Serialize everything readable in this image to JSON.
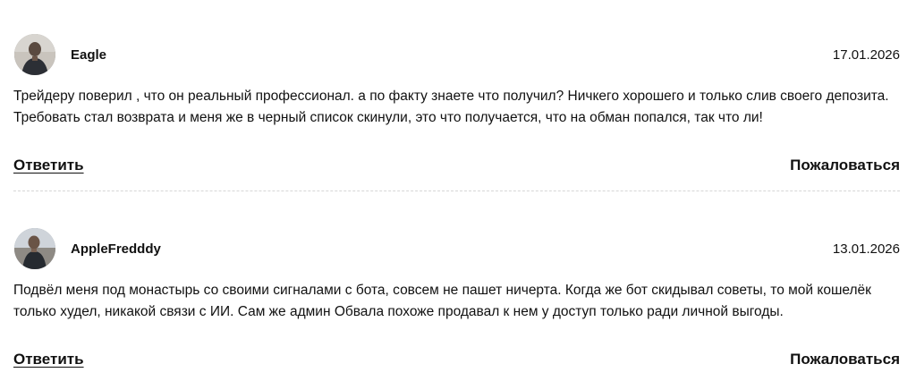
{
  "comments": [
    {
      "author": "Eagle",
      "date": "17.01.2026",
      "text": "Трейдеру поверил , что он реальный профессионал. а по факту знаете что получил? Ничкего хорошего и только слив своего депозита. Требовать стал возврата и меня же в черный список скинули, это что получается, что на обман попался, так что ли!",
      "reply_label": "Ответить",
      "report_label": "Пожаловаться"
    },
    {
      "author": "AppleFredddy",
      "date": "13.01.2026",
      "text": "Подвёл меня под монастырь со своими сигналами с бота, совсем не пашет ничерта. Когда же бот скидывал советы, то мой кошелёк только худел, никакой связи с ИИ. Сам же админ Обвала похоже продавал к нем у доступ только ради личной выгоды.",
      "reply_label": "Ответить",
      "report_label": "Пожаловаться"
    }
  ],
  "colors": {
    "text": "#111111",
    "divider": "#d6d6d6",
    "background": "#ffffff"
  },
  "icons": [
    "avatar-photo"
  ]
}
